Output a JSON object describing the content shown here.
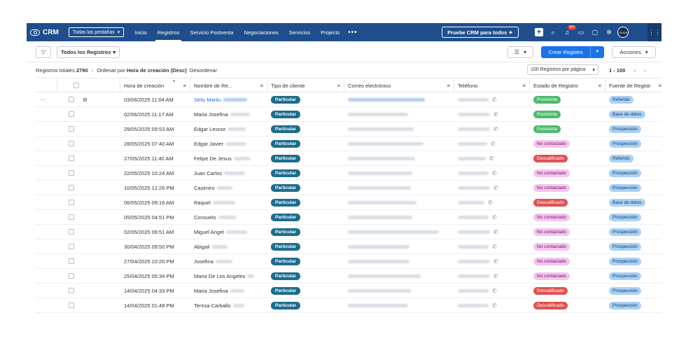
{
  "topnav": {
    "app_name": "CRM",
    "tabs_dropdown": "Todas las pestañas",
    "links": [
      "Inicio",
      "Registros",
      "Servicio Postventa",
      "Negociaciones",
      "Servicios",
      "Projects"
    ],
    "active_link": "Registros",
    "more": "•••",
    "promo": "Pruebe CRM para todos",
    "promo_icon": "✦",
    "notif_badge": "99+",
    "avatar_text": "CUIDA",
    "colors": {
      "nav_bg": "#1f4e8c",
      "accent": "#1a73e8"
    }
  },
  "toolbar": {
    "view_label": "Todos los Registros",
    "create_label": "Crear Registro",
    "actions_label": "Acciones"
  },
  "summary": {
    "total_label": "Registros totales",
    "total_count": "2790",
    "order_label": "Ordenar por",
    "order_field": "Hora de creación (Desc)",
    "unsort": "Desordenar",
    "per_page": "100 Registros por página",
    "range": "1 - 100"
  },
  "table": {
    "columns": [
      "Hora de creación",
      "Nombre de Re...",
      "Tipo de cliente",
      "Correo electrónico",
      "Teléfono",
      "Estado de Registro",
      "Fuente de Registr"
    ],
    "rows": [
      {
        "time": "03/06/2025 11:04 AM",
        "name": "Seily Marilu",
        "tipo": "Particular",
        "estado": "Postventa",
        "estado_color": "green",
        "fuente": "Referido"
      },
      {
        "time": "02/06/2025 11:17 AM",
        "name": "Maria Josefina",
        "tipo": "Particular",
        "estado": "Postventa",
        "estado_color": "green",
        "fuente": "Base de datos"
      },
      {
        "time": "29/05/2025 09:53 AM",
        "name": "Edgar Leonor",
        "tipo": "Particular",
        "estado": "Postventa",
        "estado_color": "green",
        "fuente": "Prospección"
      },
      {
        "time": "28/05/2025 07:40 AM",
        "name": "Edgar Javier",
        "tipo": "Particular",
        "estado": "No contactado",
        "estado_color": "pink",
        "fuente": "Prospección"
      },
      {
        "time": "27/05/2025 11:40 AM",
        "name": "Felipe De Jesus",
        "tipo": "Particular",
        "estado": "Descalificado",
        "estado_color": "red",
        "fuente": "Referido"
      },
      {
        "time": "22/05/2025 10:24 AM",
        "name": "Juan Carlos",
        "tipo": "Particular",
        "estado": "No contactado",
        "estado_color": "pink",
        "fuente": "Prospección"
      },
      {
        "time": "10/05/2025 12:26 PM",
        "name": "Casimiro",
        "tipo": "Particular",
        "estado": "No contactado",
        "estado_color": "pink",
        "fuente": "Prospección"
      },
      {
        "time": "06/05/2025 09:16 AM",
        "name": "Raquel",
        "tipo": "Particular",
        "estado": "Descalificado",
        "estado_color": "red",
        "fuente": "Base de datos"
      },
      {
        "time": "05/05/2025 04:51 PM",
        "name": "Consuelo",
        "tipo": "Particular",
        "estado": "No contactado",
        "estado_color": "pink",
        "fuente": "Prospección"
      },
      {
        "time": "02/05/2025 09:51 AM",
        "name": "Miguel Angel",
        "tipo": "Particular",
        "estado": "No contactado",
        "estado_color": "pink",
        "fuente": "Prospección"
      },
      {
        "time": "30/04/2025 09:50 PM",
        "name": "Abigail",
        "tipo": "Particular",
        "estado": "No contactado",
        "estado_color": "pink",
        "fuente": "Prospección"
      },
      {
        "time": "27/04/2025 10:20 PM",
        "name": "Josefina",
        "tipo": "Particular",
        "estado": "No contactado",
        "estado_color": "pink",
        "fuente": "Prospección"
      },
      {
        "time": "25/04/2025 05:34 PM",
        "name": "Maria De Los Angeles",
        "tipo": "Particular",
        "estado": "No contactado",
        "estado_color": "pink",
        "fuente": "Prospección"
      },
      {
        "time": "14/04/2025 04:33 PM",
        "name": "Maria Josefina",
        "tipo": "Particular",
        "estado": "Descalificado",
        "estado_color": "red",
        "fuente": "Prospección"
      },
      {
        "time": "14/04/2025 01:48 PM",
        "name": "Teresa Carballo",
        "tipo": "Particular",
        "estado": "Descalificado",
        "estado_color": "red",
        "fuente": "Prospección"
      }
    ]
  }
}
